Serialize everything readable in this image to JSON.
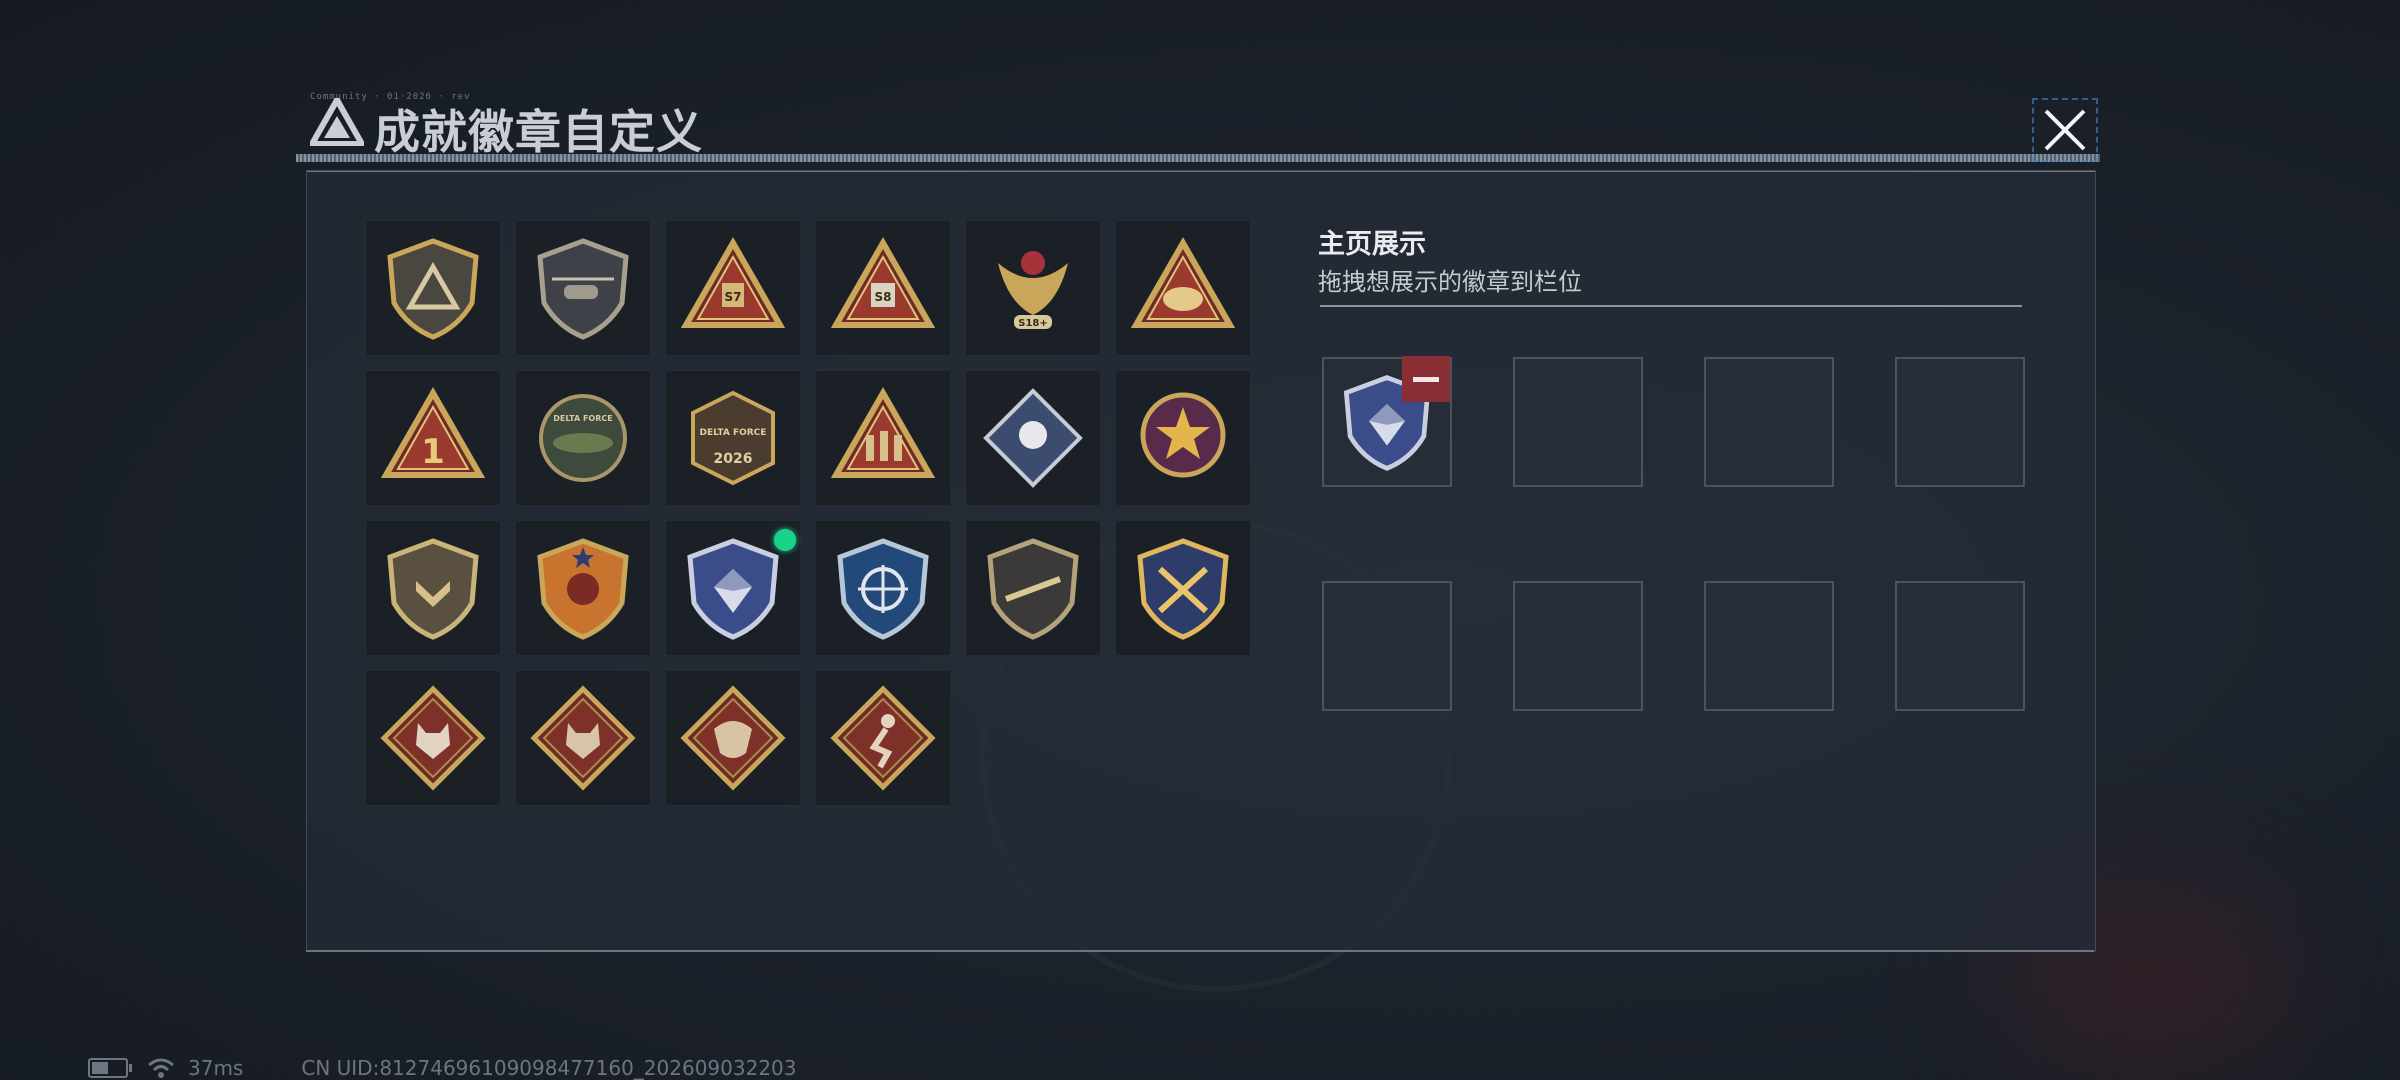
{
  "window": {
    "title": "成就徽章自定义",
    "tiny_header_text": "Community · 01·2026 · rev"
  },
  "showcase": {
    "title": "主页展示",
    "subtitle": "拖拽想展示的徽章到栏位",
    "slots": [
      {
        "filled": true,
        "badge": "blue-diamond-shield"
      },
      {
        "filled": false
      },
      {
        "filled": false
      },
      {
        "filled": false
      },
      {
        "filled": false
      },
      {
        "filled": false
      },
      {
        "filled": false
      },
      {
        "filled": false
      }
    ]
  },
  "badges": [
    {
      "name": "delta-shield-badge",
      "equipped": false
    },
    {
      "name": "helicopter-shield-badge",
      "equipped": false
    },
    {
      "name": "s7-triangle-badge",
      "label": "S7",
      "equipped": false
    },
    {
      "name": "s8-triangle-badge",
      "label": "S8",
      "equipped": false
    },
    {
      "name": "eagle-s18-badge",
      "label": "S18+",
      "equipped": false
    },
    {
      "name": "helmet-triangle-badge",
      "equipped": false
    },
    {
      "name": "number-one-triangle-badge",
      "label": "1",
      "equipped": false
    },
    {
      "name": "delta-force-crocodile-badge",
      "label": "DELTA FORCE",
      "equipped": false
    },
    {
      "name": "delta-force-2026-badge",
      "label": "2026",
      "equipped": false
    },
    {
      "name": "soldiers-triangle-badge",
      "equipped": false
    },
    {
      "name": "rose-diamond-badge",
      "equipped": false
    },
    {
      "name": "star-medal-badge",
      "equipped": false
    },
    {
      "name": "gold-chevron-shield-badge",
      "equipped": false
    },
    {
      "name": "orange-star-shield-badge",
      "equipped": false
    },
    {
      "name": "blue-diamond-shield-badge",
      "equipped": true
    },
    {
      "name": "sniper-crosshair-shield-badge",
      "equipped": false
    },
    {
      "name": "rifle-shield-badge",
      "equipped": false
    },
    {
      "name": "gold-crossed-blades-badge",
      "equipped": false
    },
    {
      "name": "wolf-diamond-badge-1",
      "equipped": false
    },
    {
      "name": "wolf-diamond-badge-2",
      "equipped": false
    },
    {
      "name": "dragon-diamond-badge",
      "equipped": false
    },
    {
      "name": "runner-diamond-badge",
      "equipped": false
    }
  ],
  "colors": {
    "equipped_dot": "#1ad38a",
    "remove_button": "#8b2e34",
    "gold": "#c9a659",
    "dark_red": "#6e2a24"
  },
  "status_bar": {
    "ping": "37ms",
    "uid": "CN UID:81274696109098477160_202609032203"
  }
}
